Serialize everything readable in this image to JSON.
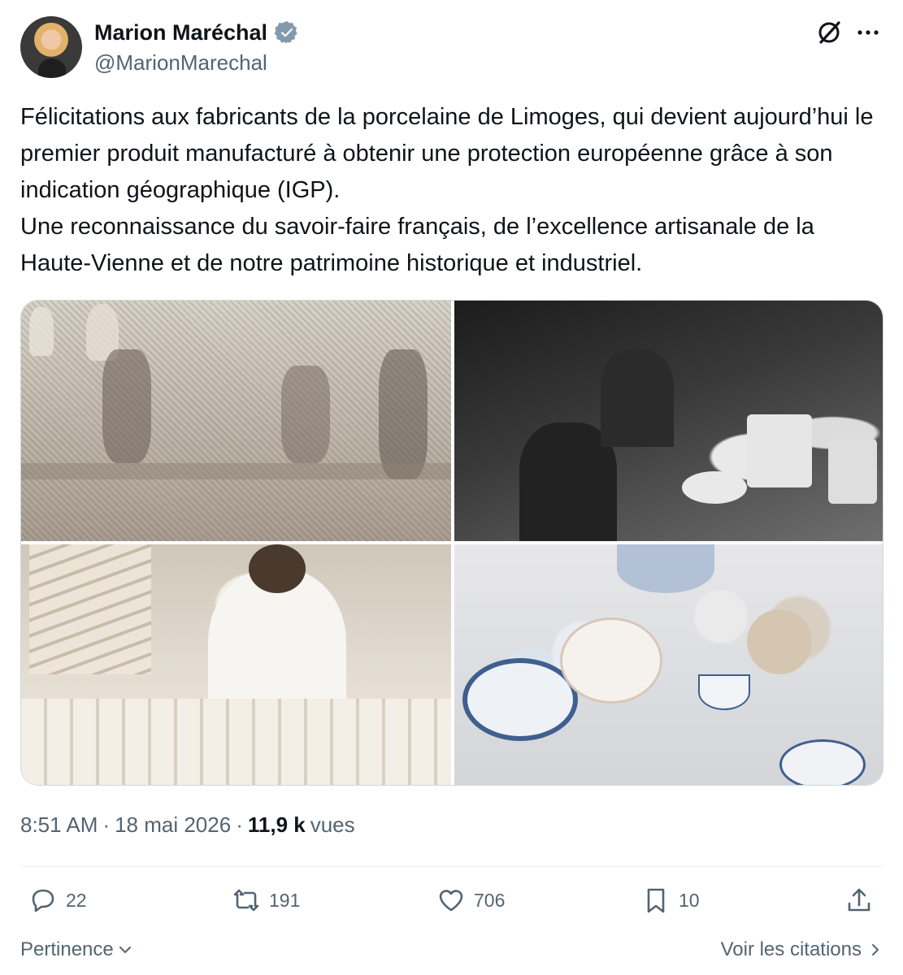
{
  "tweet": {
    "author_name": "Marion Maréchal",
    "handle": "@MarionMarechal",
    "text": "Félicitations aux fabricants de la porcelaine de Limoges, qui devient aujourd’hui le premier produit manufacturé à obtenir une protection européenne grâce à son indication géographique (IGP).\nUne reconnaissance du savoir-faire français, de l’excellence artisanale de la Haute-Vienne et de notre patrimoine historique et industriel.",
    "time": "8:51 AM",
    "date": "18 mai 2026",
    "views_count": "11,9 k",
    "views_label": "vues",
    "separator": "·"
  },
  "actions": {
    "replies": "22",
    "reposts": "191",
    "likes": "706",
    "bookmarks": "10"
  },
  "footer": {
    "sort_label": "Pertinence",
    "quotes_label": "Voir les citations"
  },
  "icons": {
    "verified": "verified-badge-icon",
    "grok": "grok-icon",
    "more": "more-icon",
    "reply": "reply-icon",
    "repost": "repost-icon",
    "like": "heart-icon",
    "bookmark": "bookmark-icon",
    "share": "share-icon"
  },
  "colors": {
    "text": "#0f1419",
    "secondary": "#536471",
    "verified": "#829aab",
    "border": "#cfd9de"
  }
}
